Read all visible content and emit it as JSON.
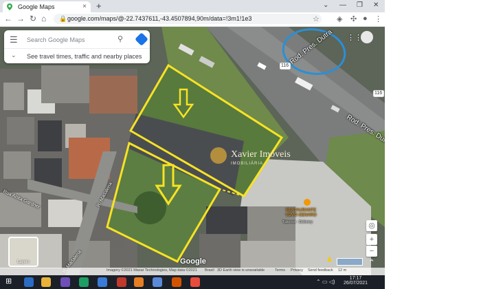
{
  "browser": {
    "tab_title": "Google Maps",
    "tab_close": "×",
    "new_tab": "+",
    "url": "google.com/maps/@-22.7437611,-43.4507894,90m/data=!3m1!1e3",
    "back": "←",
    "forward": "→",
    "reload": "C"
  },
  "search": {
    "placeholder": "Search Google Maps",
    "hint": "See travel times, traffic and nearby places"
  },
  "map_labels": {
    "highway_1": "Rod. Pres. Dutra",
    "highway_2": "Rod. Pres. Dutra",
    "route_badge_1": "116",
    "route_badge_2": "116",
    "street_1": "Rua Anita Gardner",
    "street_2": "R. Madalena",
    "street_3": "R. Madalena",
    "restaurant_name": "RESTAURANTE VOVÓ GENARO",
    "restaurant_sub": "Takeout · Delivery",
    "watermark_title": "Xavier Imóveis",
    "watermark_sub": "IMOBILIÁRIA",
    "logo": "Google"
  },
  "controls": {
    "layers_label": "Layers",
    "zoom_in": "+",
    "zoom_out": "−"
  },
  "footer": {
    "imagery": "Imagery ©2021 Maxar Technologies, Map data ©2021",
    "brazil": "Brazil",
    "earth": "3D Earth view is unavailable",
    "terms": "Terms",
    "privacy": "Privacy",
    "feedback": "Send feedback",
    "scale": "12 m"
  },
  "taskbar": {
    "time": "17:17",
    "date": "26/07/2021"
  },
  "colors": {
    "highlight": "#f7e323",
    "annotation": "#2b8fd6",
    "maps_blue": "#1a73e8"
  }
}
